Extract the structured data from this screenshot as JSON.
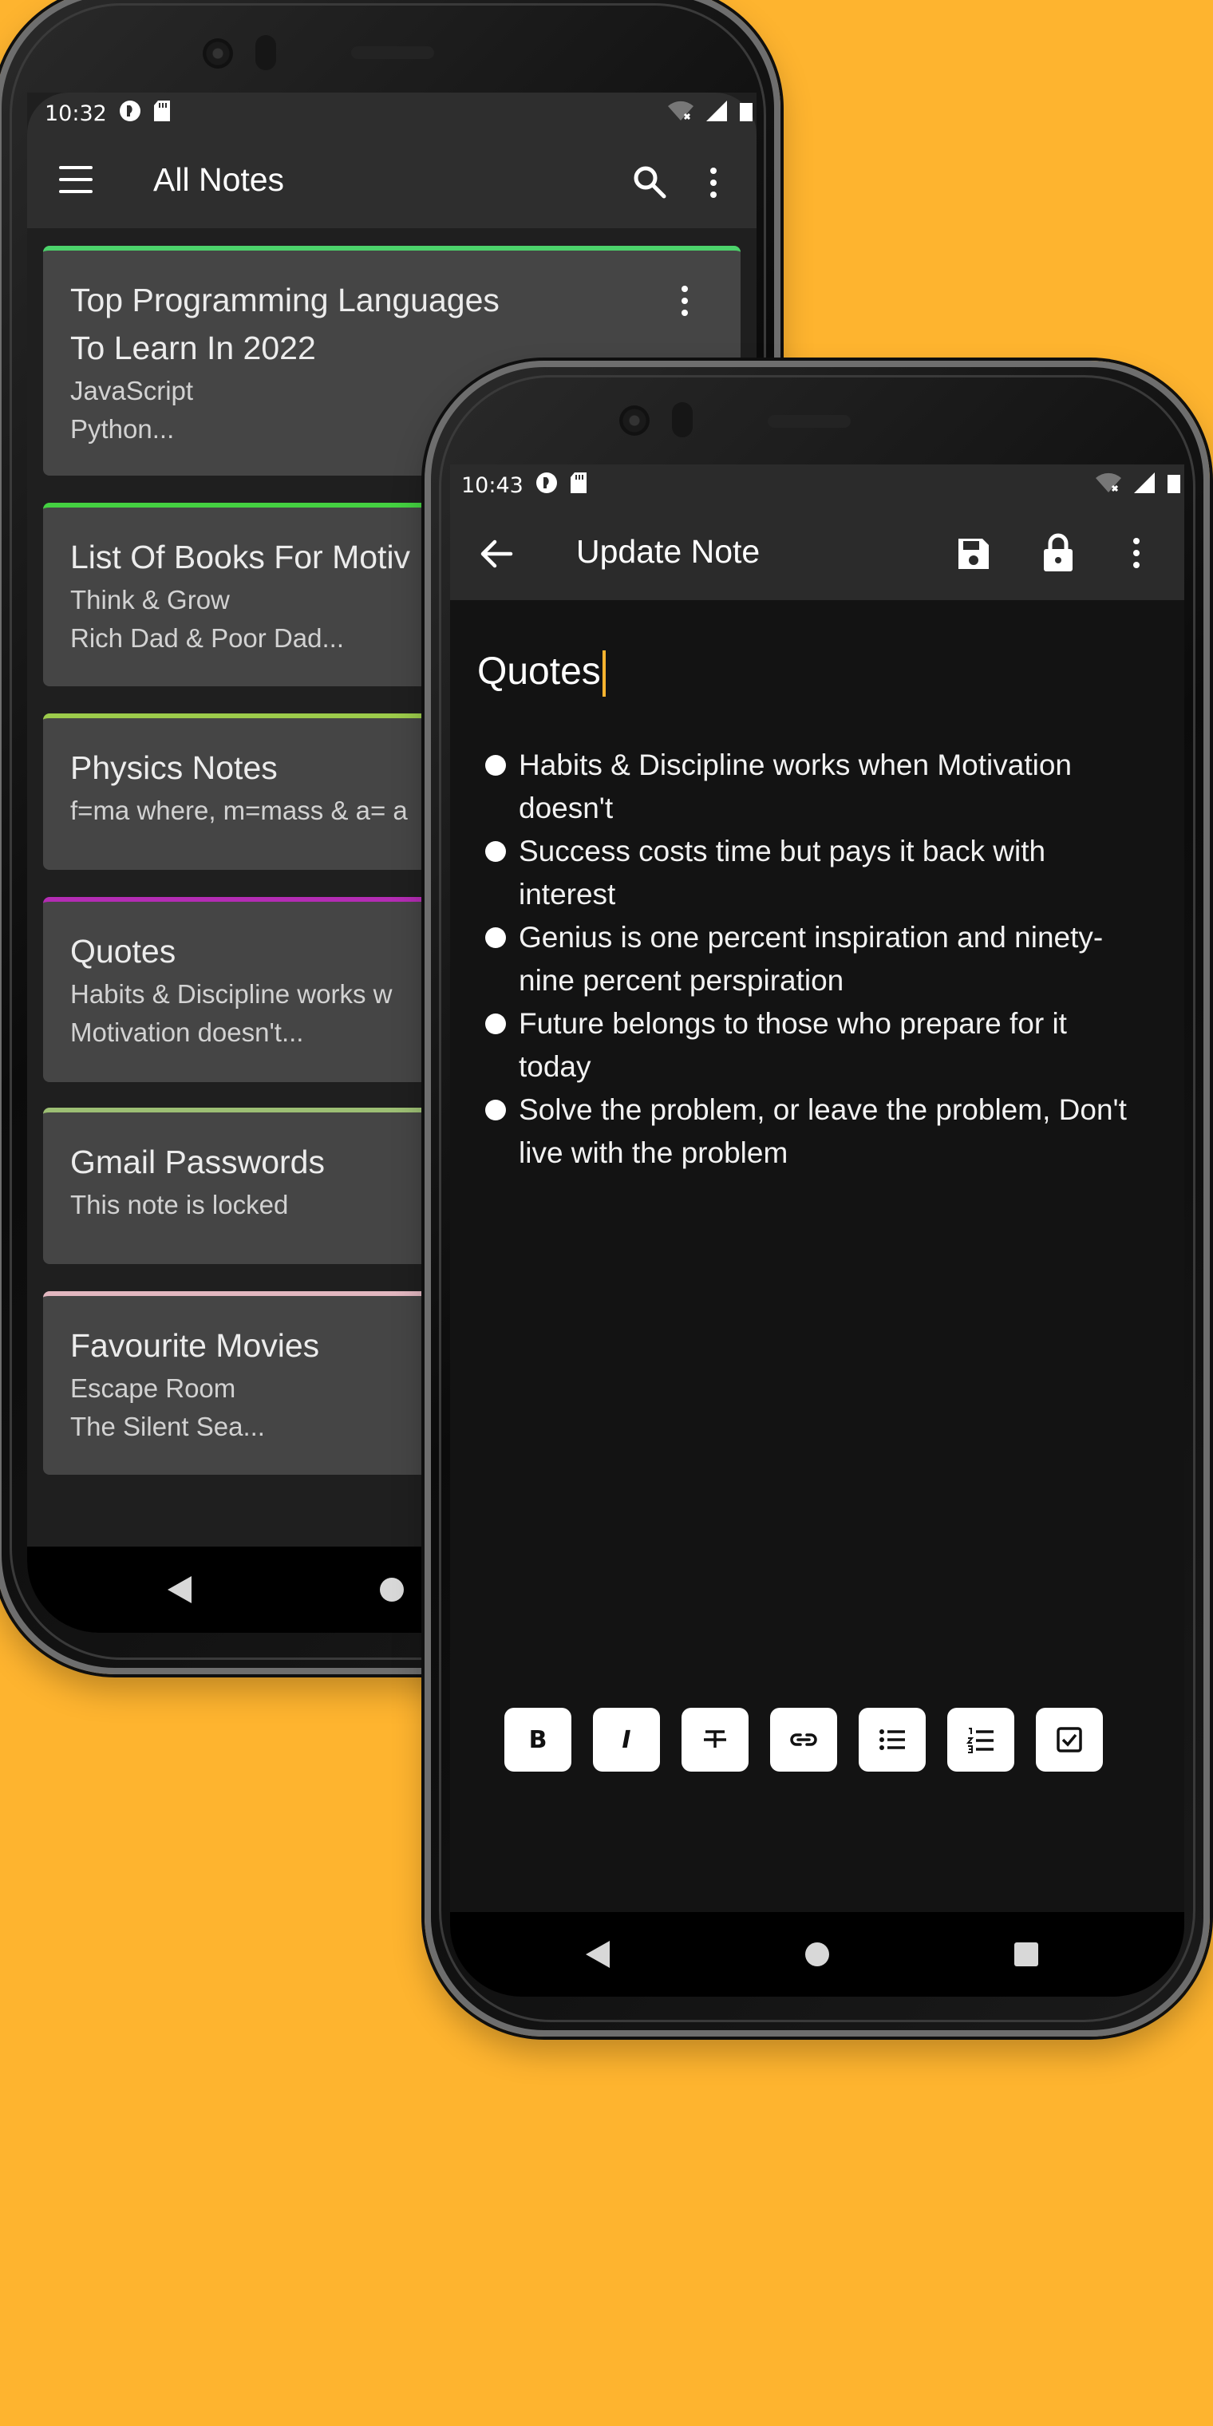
{
  "back_phone": {
    "status": {
      "time": "10:32"
    },
    "appbar": {
      "title": "All Notes"
    },
    "notes": [
      {
        "title": "Top Programming Languages\nTo Learn In 2022",
        "body": " JavaScript\n Python...",
        "accent": "#4CD36B"
      },
      {
        "title": "List Of Books For Motiv",
        "body": " Think & Grow\n Rich Dad & Poor Dad...",
        "accent": "#44D141"
      },
      {
        "title": "Physics Notes",
        "body": "f=ma where, m=mass & a= a",
        "accent": "#9CCB4B"
      },
      {
        "title": "Quotes",
        "body": " Habits & Discipline works w\nMotivation doesn't...",
        "accent": "#B42CB4"
      },
      {
        "title": "Gmail Passwords",
        "body": "This note is locked",
        "accent": "#9DBF74"
      },
      {
        "title": "Favourite Movies",
        "body": " Escape Room\n The Silent Sea...",
        "accent": "#E2B7C0"
      }
    ]
  },
  "front_phone": {
    "status": {
      "time": "10:43"
    },
    "appbar": {
      "title": "Update Note"
    },
    "note": {
      "title": "Quotes",
      "items": [
        "Habits & Discipline works when Motivation doesn't",
        "Success costs time but pays it back with interest",
        "Genius is one percent inspiration and ninety-nine percent perspiration",
        "Future belongs to those who prepare for it today",
        "Solve the problem, or leave the problem, Don't live with the problem"
      ]
    },
    "toolbar": {
      "bold": "B",
      "italic": "I",
      "icons": [
        "bold-icon",
        "italic-icon",
        "strikethrough-icon",
        "link-icon",
        "bullet-list-icon",
        "numbered-list-icon",
        "checkbox-icon"
      ]
    }
  },
  "colors": {
    "background": "#FEB42F",
    "caret": "#FEB42F"
  }
}
